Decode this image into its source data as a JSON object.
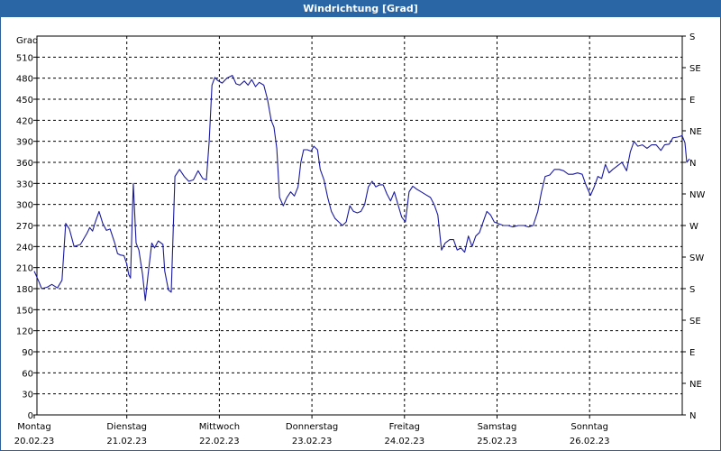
{
  "title": "Windrichtung [Grad]",
  "ylabel": "Grad",
  "chart_data": {
    "type": "line",
    "title": "Windrichtung [Grad]",
    "ylabel": "Grad",
    "ylim": [
      0,
      540
    ],
    "y_ticks": [
      0,
      30,
      60,
      90,
      120,
      150,
      180,
      210,
      240,
      270,
      300,
      330,
      360,
      390,
      420,
      450,
      480,
      510
    ],
    "right_ticks": [
      {
        "value": 0,
        "label": "N"
      },
      {
        "value": 45,
        "label": "NE"
      },
      {
        "value": 90,
        "label": "E"
      },
      {
        "value": 135,
        "label": "SE"
      },
      {
        "value": 180,
        "label": "S"
      },
      {
        "value": 225,
        "label": "SW"
      },
      {
        "value": 270,
        "label": "W"
      },
      {
        "value": 315,
        "label": "NW"
      },
      {
        "value": 360,
        "label": "N"
      },
      {
        "value": 405,
        "label": "NE"
      },
      {
        "value": 450,
        "label": "E"
      },
      {
        "value": 495,
        "label": "SE"
      },
      {
        "value": 540,
        "label": "S"
      }
    ],
    "x_ticks": [
      {
        "day": "Montag",
        "date": "20.02.23"
      },
      {
        "day": "Dienstag",
        "date": "21.02.23"
      },
      {
        "day": "Mittwoch",
        "date": "22.02.23"
      },
      {
        "day": "Donnerstag",
        "date": "23.02.23"
      },
      {
        "day": "Freitag",
        "date": "24.02.23"
      },
      {
        "day": "Samstag",
        "date": "25.02.23"
      },
      {
        "day": "Sonntag",
        "date": "26.02.23"
      }
    ],
    "grid": true,
    "series_color": "#1a1aa0",
    "series": [
      {
        "x_unit": "days from Montag 20.02.23 00:00",
        "points": [
          [
            0.0,
            205
          ],
          [
            0.05,
            190
          ],
          [
            0.08,
            180
          ],
          [
            0.14,
            182
          ],
          [
            0.19,
            186
          ],
          [
            0.25,
            181
          ],
          [
            0.3,
            192
          ],
          [
            0.34,
            273
          ],
          [
            0.38,
            265
          ],
          [
            0.43,
            240
          ],
          [
            0.5,
            243
          ],
          [
            0.57,
            259
          ],
          [
            0.6,
            267
          ],
          [
            0.63,
            262
          ],
          [
            0.66,
            275
          ],
          [
            0.7,
            290
          ],
          [
            0.74,
            273
          ],
          [
            0.78,
            263
          ],
          [
            0.82,
            265
          ],
          [
            0.87,
            245
          ],
          [
            0.9,
            230
          ],
          [
            0.93,
            228
          ],
          [
            0.97,
            227
          ],
          [
            1.0,
            215
          ],
          [
            1.02,
            200
          ],
          [
            1.04,
            195
          ],
          [
            1.07,
            330
          ],
          [
            1.1,
            245
          ],
          [
            1.13,
            235
          ],
          [
            1.17,
            200
          ],
          [
            1.2,
            163
          ],
          [
            1.23,
            200
          ],
          [
            1.27,
            245
          ],
          [
            1.3,
            238
          ],
          [
            1.34,
            248
          ],
          [
            1.39,
            243
          ],
          [
            1.41,
            205
          ],
          [
            1.45,
            178
          ],
          [
            1.48,
            175
          ],
          [
            1.52,
            340
          ],
          [
            1.57,
            350
          ],
          [
            1.62,
            340
          ],
          [
            1.67,
            333
          ],
          [
            1.72,
            335
          ],
          [
            1.77,
            348
          ],
          [
            1.82,
            337
          ],
          [
            1.86,
            335
          ],
          [
            1.89,
            390
          ],
          [
            1.92,
            470
          ],
          [
            1.95,
            481
          ],
          [
            1.98,
            477
          ],
          [
            2.03,
            473
          ],
          [
            2.08,
            480
          ],
          [
            2.14,
            484
          ],
          [
            2.18,
            472
          ],
          [
            2.22,
            470
          ],
          [
            2.27,
            476
          ],
          [
            2.31,
            470
          ],
          [
            2.35,
            478
          ],
          [
            2.39,
            468
          ],
          [
            2.43,
            474
          ],
          [
            2.48,
            470
          ],
          [
            2.52,
            450
          ],
          [
            2.56,
            420
          ],
          [
            2.59,
            410
          ],
          [
            2.62,
            380
          ],
          [
            2.65,
            310
          ],
          [
            2.69,
            298
          ],
          [
            2.73,
            310
          ],
          [
            2.77,
            318
          ],
          [
            2.81,
            312
          ],
          [
            2.85,
            325
          ],
          [
            2.88,
            360
          ],
          [
            2.91,
            378
          ],
          [
            2.95,
            378
          ],
          [
            2.99,
            376
          ],
          [
            3.02,
            383
          ],
          [
            3.06,
            378
          ],
          [
            3.09,
            350
          ],
          [
            3.13,
            335
          ],
          [
            3.17,
            310
          ],
          [
            3.21,
            290
          ],
          [
            3.25,
            280
          ],
          [
            3.29,
            275
          ],
          [
            3.33,
            270
          ],
          [
            3.37,
            275
          ],
          [
            3.41,
            298
          ],
          [
            3.45,
            290
          ],
          [
            3.49,
            288
          ],
          [
            3.53,
            290
          ],
          [
            3.57,
            300
          ],
          [
            3.61,
            325
          ],
          [
            3.65,
            333
          ],
          [
            3.69,
            325
          ],
          [
            3.73,
            328
          ],
          [
            3.77,
            328
          ],
          [
            3.81,
            315
          ],
          [
            3.85,
            305
          ],
          [
            3.89,
            318
          ],
          [
            3.93,
            300
          ],
          [
            3.97,
            282
          ],
          [
            4.01,
            275
          ],
          [
            4.05,
            318
          ],
          [
            4.09,
            326
          ],
          [
            4.13,
            322
          ],
          [
            4.18,
            318
          ],
          [
            4.23,
            314
          ],
          [
            4.28,
            310
          ],
          [
            4.32,
            300
          ],
          [
            4.36,
            285
          ],
          [
            4.4,
            235
          ],
          [
            4.44,
            245
          ],
          [
            4.49,
            250
          ],
          [
            4.53,
            250
          ],
          [
            4.57,
            235
          ],
          [
            4.61,
            238
          ],
          [
            4.65,
            232
          ],
          [
            4.69,
            255
          ],
          [
            4.73,
            240
          ],
          [
            4.77,
            255
          ],
          [
            4.81,
            260
          ],
          [
            4.85,
            275
          ],
          [
            4.89,
            290
          ],
          [
            4.93,
            285
          ],
          [
            4.97,
            275
          ],
          [
            5.01,
            273
          ],
          [
            5.07,
            270
          ],
          [
            5.12,
            270
          ],
          [
            5.17,
            268
          ],
          [
            5.23,
            270
          ],
          [
            5.29,
            270
          ],
          [
            5.34,
            268
          ],
          [
            5.39,
            270
          ],
          [
            5.44,
            290
          ],
          [
            5.48,
            318
          ],
          [
            5.52,
            340
          ],
          [
            5.57,
            342
          ],
          [
            5.62,
            350
          ],
          [
            5.67,
            350
          ],
          [
            5.72,
            348
          ],
          [
            5.77,
            343
          ],
          [
            5.82,
            343
          ],
          [
            5.87,
            345
          ],
          [
            5.92,
            343
          ],
          [
            5.96,
            328
          ],
          [
            6.01,
            313
          ],
          [
            6.05,
            325
          ],
          [
            6.09,
            340
          ],
          [
            6.13,
            337
          ],
          [
            6.17,
            357
          ],
          [
            6.21,
            345
          ],
          [
            6.25,
            350
          ],
          [
            6.3,
            355
          ],
          [
            6.35,
            360
          ],
          [
            6.4,
            348
          ],
          [
            6.44,
            375
          ],
          [
            6.48,
            390
          ],
          [
            6.52,
            383
          ],
          [
            6.57,
            385
          ],
          [
            6.62,
            380
          ],
          [
            6.67,
            385
          ],
          [
            6.72,
            385
          ],
          [
            6.77,
            377
          ],
          [
            6.81,
            385
          ],
          [
            6.86,
            386
          ],
          [
            6.9,
            395
          ],
          [
            6.95,
            396
          ],
          [
            7.0,
            398
          ],
          [
            7.03,
            388
          ],
          [
            7.05,
            360
          ],
          [
            7.08,
            365
          ]
        ]
      }
    ]
  }
}
